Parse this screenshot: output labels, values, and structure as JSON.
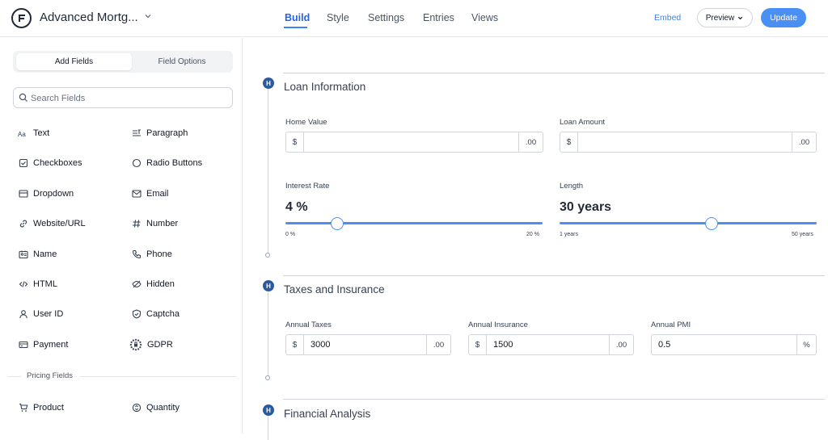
{
  "header": {
    "form_title": "Advanced Mortg...",
    "tabs": [
      "Build",
      "Style",
      "Settings",
      "Entries",
      "Views"
    ],
    "active_tab": "Build",
    "embed_label": "Embed",
    "preview_label": "Preview",
    "update_label": "Update",
    "accent_color": "#4a90f4"
  },
  "sidebar": {
    "segment": {
      "add_fields": "Add Fields",
      "field_options": "Field Options"
    },
    "search_placeholder": "Search Fields",
    "fields": [
      {
        "label": "Text",
        "icon": "text-icon"
      },
      {
        "label": "Paragraph",
        "icon": "paragraph-icon"
      },
      {
        "label": "Checkboxes",
        "icon": "checkbox-icon"
      },
      {
        "label": "Radio Buttons",
        "icon": "radio-icon"
      },
      {
        "label": "Dropdown",
        "icon": "dropdown-icon"
      },
      {
        "label": "Email",
        "icon": "email-icon"
      },
      {
        "label": "Website/URL",
        "icon": "link-icon"
      },
      {
        "label": "Number",
        "icon": "hash-icon"
      },
      {
        "label": "Name",
        "icon": "id-card-icon"
      },
      {
        "label": "Phone",
        "icon": "phone-icon"
      },
      {
        "label": "HTML",
        "icon": "code-icon"
      },
      {
        "label": "Hidden",
        "icon": "eye-slash-icon"
      },
      {
        "label": "User ID",
        "icon": "user-icon"
      },
      {
        "label": "Captcha",
        "icon": "shield-icon"
      },
      {
        "label": "Payment",
        "icon": "card-icon"
      },
      {
        "label": "GDPR",
        "icon": "gdpr-stars-icon"
      }
    ],
    "pricing_label": "Pricing Fields",
    "pricing_fields": [
      {
        "label": "Product",
        "icon": "cart-icon"
      },
      {
        "label": "Quantity",
        "icon": "quantity-icon"
      }
    ]
  },
  "sections": {
    "loan": {
      "badge": "H",
      "title": "Loan Information",
      "home_value": {
        "label": "Home Value",
        "prefix": "$",
        "value": "",
        "suffix": ".00"
      },
      "loan_amount": {
        "label": "Loan Amount",
        "prefix": "$",
        "value": "",
        "suffix": ".00"
      },
      "interest_rate": {
        "label": "Interest Rate",
        "display": "4 %",
        "min_label": "0 %",
        "max_label": "20 %",
        "min": 0,
        "max": 20,
        "value": 4
      },
      "length": {
        "label": "Length",
        "display": "30 years",
        "min_label": "1 years",
        "max_label": "50 years",
        "min": 1,
        "max": 50,
        "value": 30
      }
    },
    "taxes": {
      "badge": "H",
      "title": "Taxes and Insurance",
      "annual_taxes": {
        "label": "Annual Taxes",
        "prefix": "$",
        "value": "3000",
        "suffix": ".00"
      },
      "annual_insurance": {
        "label": "Annual Insurance",
        "prefix": "$",
        "value": "1500",
        "suffix": ".00"
      },
      "annual_pmi": {
        "label": "Annual PMI",
        "value": "0.5",
        "suffix": "%"
      }
    },
    "financial": {
      "badge": "H",
      "title": "Financial Analysis"
    }
  }
}
